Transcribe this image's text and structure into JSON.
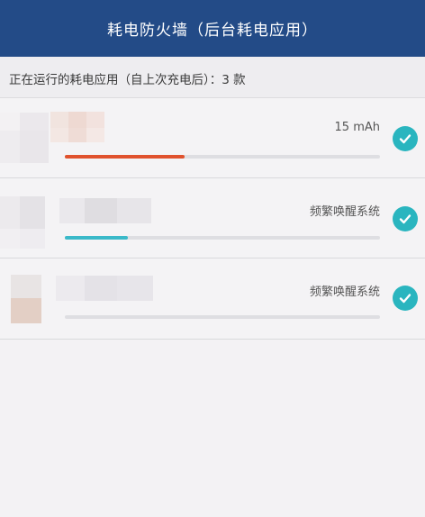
{
  "header": {
    "title": "耗电防火墙（后台耗电应用）"
  },
  "subheader": {
    "text": "正在运行的耗电应用（自上次充电后）：3 款"
  },
  "apps": [
    {
      "usage": "15 mAh",
      "progress": 0.38,
      "bar_color": "#e0522e",
      "checked": true
    },
    {
      "usage": "频繁唤醒系统",
      "progress": 0.2,
      "bar_color": "#3bb9c9",
      "checked": true
    },
    {
      "usage": "频繁唤醒系统",
      "progress": 0.0,
      "bar_color": "#3bb9c9",
      "checked": true
    }
  ],
  "colors": {
    "header_bg": "#234b87",
    "accent": "#2ab5bf",
    "page_bg": "#f3f2f4"
  },
  "icons": {
    "check": "check-icon"
  }
}
